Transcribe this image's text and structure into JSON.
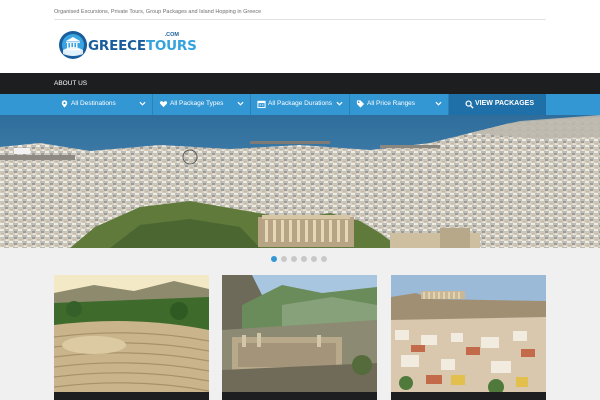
{
  "header": {
    "tagline": "Organised Excursions, Private Tours, Group Packages and Island Hopping in Greece",
    "logo_text_1": "GREECE",
    "logo_text_2": "TOURS",
    "logo_com": ".COM"
  },
  "nav": {
    "items": [
      {
        "label": "ABOUT US"
      }
    ]
  },
  "search": {
    "filters": [
      {
        "label": "All Destinations",
        "icon": "map-pin-icon"
      },
      {
        "label": "All Package Types",
        "icon": "heart-icon"
      },
      {
        "label": "All Package Durations",
        "icon": "calendar-icon"
      },
      {
        "label": "All Price Ranges",
        "icon": "price-tag-icon"
      }
    ],
    "button_label": "VIEW PACKAGES",
    "button_icon": "search-icon"
  },
  "slider": {
    "slide_count": 6,
    "active_index": 0
  },
  "colors": {
    "accent": "#3397d4",
    "navbar": "#1d1e20",
    "button": "#1f6fa8"
  },
  "cards": [
    {
      "image": "ancient-theatre-image"
    },
    {
      "image": "delphi-ruins-image"
    },
    {
      "image": "athens-acropolis-image"
    }
  ]
}
